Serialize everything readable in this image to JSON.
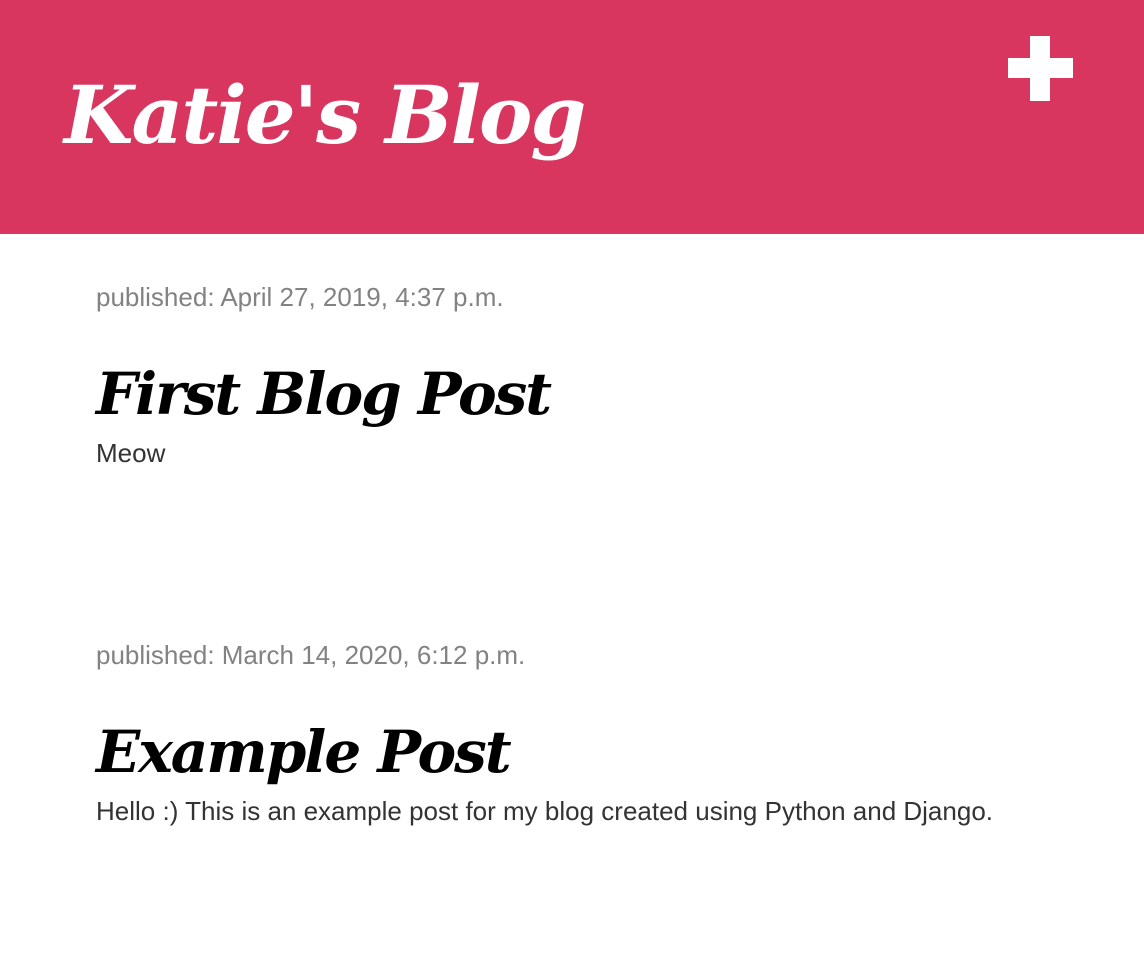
{
  "header": {
    "site_title": "Katie's Blog",
    "add_icon": "plus-icon",
    "background_color": "#d8365e"
  },
  "posts": [
    {
      "date": "published: April 27, 2019, 4:37 p.m.",
      "title": "First Blog Post",
      "body": "Meow"
    },
    {
      "date": "published: March 14, 2020, 6:12 p.m.",
      "title": "Example Post",
      "body": "Hello :) This is an example post for my blog created using Python and Django."
    }
  ]
}
